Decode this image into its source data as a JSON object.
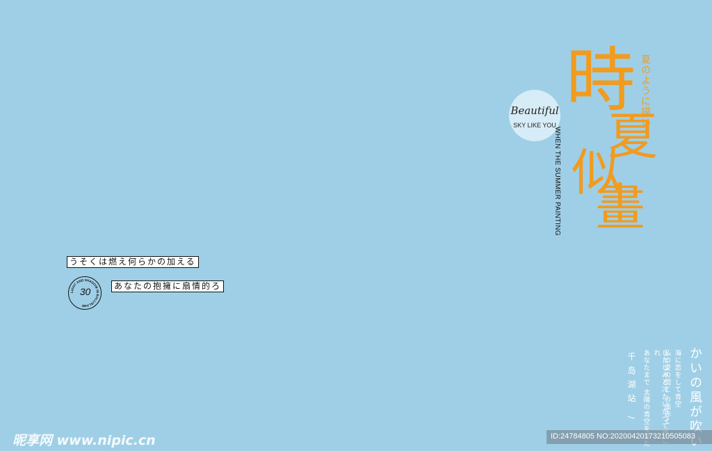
{
  "background_color": "#9fcfe6",
  "accent_color": "#f19b1f",
  "title_chars": [
    "時",
    "夏",
    "似",
    "畫"
  ],
  "subtitle_vertical": "夏のように描い",
  "circle": {
    "script": "Beautiful",
    "caption": "SKY LIKE YOU"
  },
  "vertical_english": "WHEN THE SUMMER PAINTING",
  "boxes": [
    "うそくは燃え何らかの加える",
    "あなたの抱擁に扇情的ろ"
  ],
  "badge": {
    "number": "30",
    "ring_text": "LIGHT AND SHADOW IN BALLISLAND"
  },
  "poem": {
    "large": "かいの風が吹い",
    "lines": [
      "海に恋をして青空",
      "私の愛の間こ の面赤く",
      "したしみと冷たいかつて理これ",
      "あなたまで 太陽の青空を見た"
    ]
  },
  "station": "千岛湖站 /",
  "watermark": {
    "logo": "昵享网 www.nipic.cn",
    "id_text": "ID:24784805 NO:20200420173210505083"
  }
}
